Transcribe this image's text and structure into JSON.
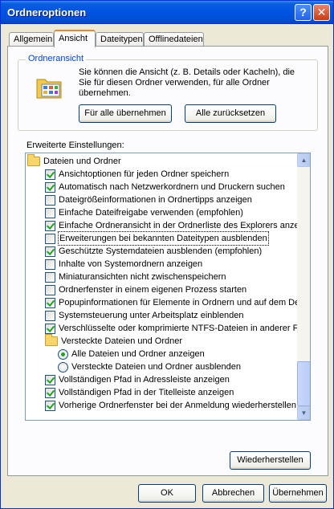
{
  "window": {
    "title": "Ordneroptionen",
    "help_symbol": "?",
    "close_symbol": "✕"
  },
  "tabs": [
    "Allgemein",
    "Ansicht",
    "Dateitypen",
    "Offlinedateien"
  ],
  "group": {
    "title": "Ordneransicht",
    "text": "Sie können die Ansicht (z. B. Details oder Kacheln), die Sie für diesen Ordner verwenden, für alle Ordner übernehmen.",
    "apply_all": "Für alle übernehmen",
    "reset_all": "Alle zurücksetzen"
  },
  "advanced_label": "Erweiterte Einstellungen:",
  "tree": [
    {
      "kind": "folder",
      "label": "Dateien und Ordner",
      "indent": 0
    },
    {
      "kind": "check",
      "label": "Ansichtoptionen für jeden Ordner speichern",
      "checked": true,
      "indent": 1
    },
    {
      "kind": "check",
      "label": "Automatisch nach Netzwerkordnern und Druckern suchen",
      "checked": true,
      "indent": 1
    },
    {
      "kind": "check",
      "label": "Dateigrößeinformationen in Ordnertipps anzeigen",
      "checked": false,
      "indent": 1
    },
    {
      "kind": "check",
      "label": "Einfache Dateifreigabe verwenden (empfohlen)",
      "checked": false,
      "indent": 1
    },
    {
      "kind": "check",
      "label": "Einfache Ordneransicht in der Ordnerliste des Explorers anzeigen",
      "checked": true,
      "indent": 1
    },
    {
      "kind": "check",
      "label": "Erweiterungen bei bekannten Dateitypen ausblenden",
      "checked": false,
      "indent": 1,
      "selected": true
    },
    {
      "kind": "check",
      "label": "Geschützte Systemdateien ausblenden (empfohlen)",
      "checked": true,
      "indent": 1
    },
    {
      "kind": "check",
      "label": "Inhalte von Systemordnern anzeigen",
      "checked": false,
      "indent": 1
    },
    {
      "kind": "check",
      "label": "Miniaturansichten nicht zwischenspeichern",
      "checked": false,
      "indent": 1
    },
    {
      "kind": "check",
      "label": "Ordnerfenster in einem eigenen Prozess starten",
      "checked": false,
      "indent": 1
    },
    {
      "kind": "check",
      "label": "Popupinformationen für Elemente in Ordnern und auf dem Desktop anzeigen",
      "checked": true,
      "indent": 1
    },
    {
      "kind": "check",
      "label": "Systemsteuerung unter Arbeitsplatz einblenden",
      "checked": false,
      "indent": 1
    },
    {
      "kind": "check",
      "label": "Verschlüsselte oder komprimierte NTFS-Dateien in anderer Farbe anzeigen",
      "checked": true,
      "indent": 1
    },
    {
      "kind": "folder",
      "label": "Versteckte Dateien und Ordner",
      "indent": 1
    },
    {
      "kind": "radio",
      "label": "Alle Dateien und Ordner anzeigen",
      "checked": true,
      "indent": 2
    },
    {
      "kind": "radio",
      "label": "Versteckte Dateien und Ordner ausblenden",
      "checked": false,
      "indent": 2
    },
    {
      "kind": "check",
      "label": "Vollständigen Pfad in Adressleiste anzeigen",
      "checked": true,
      "indent": 1
    },
    {
      "kind": "check",
      "label": "Vollständigen Pfad in der Titelleiste anzeigen",
      "checked": true,
      "indent": 1
    },
    {
      "kind": "check",
      "label": "Vorherige Ordnerfenster bei der Anmeldung wiederherstellen",
      "checked": true,
      "indent": 1
    }
  ],
  "restore_button": "Wiederherstellen",
  "footer": {
    "ok": "OK",
    "cancel": "Abbrechen",
    "apply": "Übernehmen"
  }
}
